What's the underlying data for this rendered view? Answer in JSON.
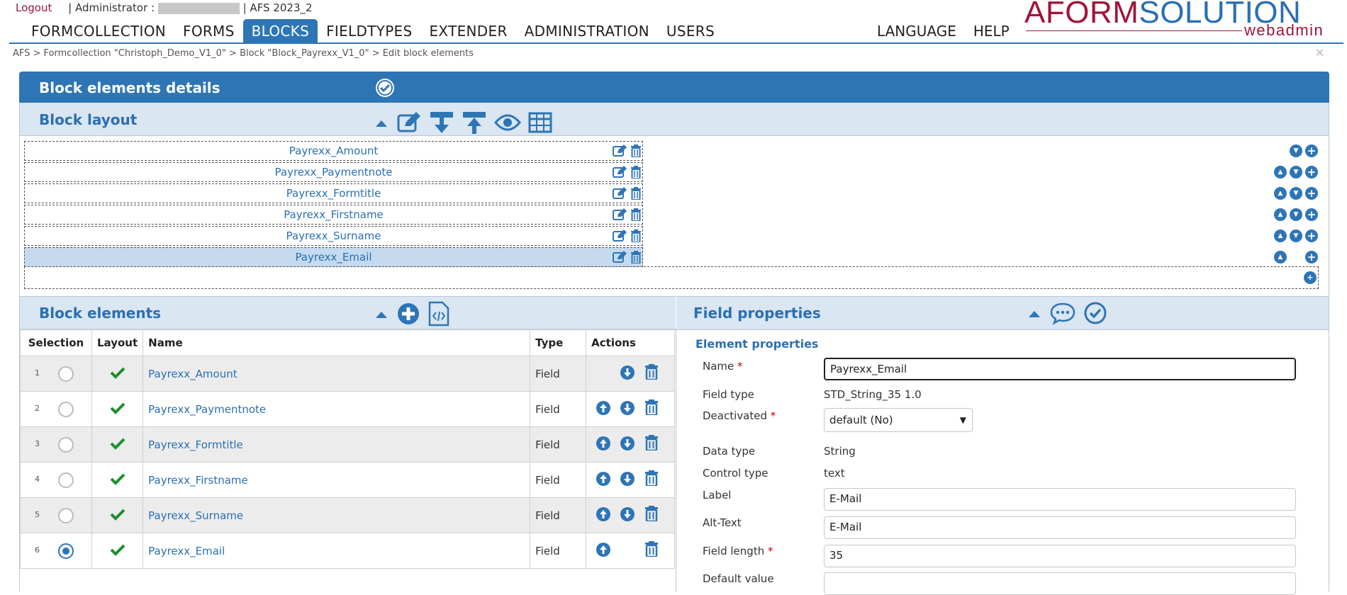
{
  "topbar": {
    "logout": "Logout",
    "user_label": "| Administrator :",
    "version": "| AFS 2023_2"
  },
  "logo": {
    "part_a": "AFORM",
    "part_b": "SOLUTION",
    "sub": "webadmin"
  },
  "nav": {
    "items": [
      "FORMCOLLECTION",
      "FORMS",
      "BLOCKS",
      "FIELDTYPES",
      "EXTENDER",
      "ADMINISTRATION",
      "USERS"
    ],
    "active": "BLOCKS",
    "right": [
      "LANGUAGE",
      "HELP"
    ]
  },
  "breadcrumb": "AFS > Formcollection \"Christoph_Demo_V1_0\" > Block \"Block_Payrexx_V1_0\" > Edit block elements",
  "details_panel": {
    "title": "Block elements details"
  },
  "block_layout": {
    "title": "Block layout",
    "rows": [
      {
        "name": "Payrexx_Amount",
        "selected": false
      },
      {
        "name": "Payrexx_Paymentnote",
        "selected": false
      },
      {
        "name": "Payrexx_Formtitle",
        "selected": false
      },
      {
        "name": "Payrexx_Firstname",
        "selected": false
      },
      {
        "name": "Payrexx_Surname",
        "selected": false
      },
      {
        "name": "Payrexx_Email",
        "selected": true
      }
    ]
  },
  "block_elements": {
    "title": "Block elements",
    "columns": [
      "Selection",
      "Layout",
      "Name",
      "Type",
      "Actions"
    ],
    "rows": [
      {
        "n": "1",
        "name": "Payrexx_Amount",
        "type": "Field",
        "selected": false
      },
      {
        "n": "2",
        "name": "Payrexx_Paymentnote",
        "type": "Field",
        "selected": false
      },
      {
        "n": "3",
        "name": "Payrexx_Formtitle",
        "type": "Field",
        "selected": false
      },
      {
        "n": "4",
        "name": "Payrexx_Firstname",
        "type": "Field",
        "selected": false
      },
      {
        "n": "5",
        "name": "Payrexx_Surname",
        "type": "Field",
        "selected": false
      },
      {
        "n": "6",
        "name": "Payrexx_Email",
        "type": "Field",
        "selected": true
      }
    ]
  },
  "field_properties": {
    "title": "Field properties",
    "section": "Element properties",
    "name_label": "Name",
    "name_value": "Payrexx_Email",
    "fieldtype_label": "Field type",
    "fieldtype_value": "STD_String_35 1.0",
    "deactivated_label": "Deactivated",
    "deactivated_value": "default (No)",
    "datatype_label": "Data type",
    "datatype_value": "String",
    "controltype_label": "Control type",
    "controltype_value": "text",
    "label_label": "Label",
    "label_value": "E-Mail",
    "alttext_label": "Alt-Text",
    "alttext_value": "E-Mail",
    "fieldlength_label": "Field length",
    "fieldlength_value": "35",
    "default_label": "Default value",
    "default_value": "",
    "required_mark": "*"
  },
  "colors": {
    "primary": "#2e75b6",
    "brand_red": "#a0143a",
    "subhead": "#dae6f1",
    "selected_row": "#c5daee",
    "check_green": "#1a8f2a"
  }
}
